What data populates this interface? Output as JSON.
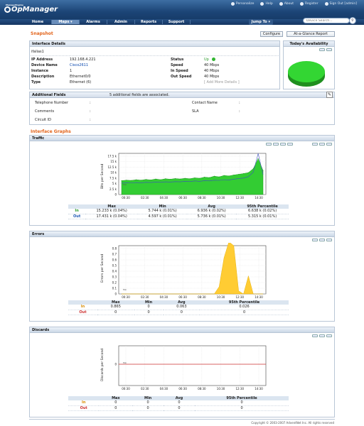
{
  "header": {
    "brand_small": "ManageEngine",
    "brand": "OpManager",
    "links": [
      "Personalize",
      "Help",
      "About",
      "Register",
      "Sign Out [admin]"
    ],
    "search_placeholder": "Device Search...",
    "jump_to": "Jump To ▾"
  },
  "nav": [
    {
      "label": "Home",
      "active": false
    },
    {
      "label": "Maps ▾",
      "active": true
    },
    {
      "label": "Alarms",
      "active": false
    },
    {
      "label": "Admin",
      "active": false
    },
    {
      "label": "Reports",
      "active": false
    },
    {
      "label": "Support",
      "active": false
    }
  ],
  "snapshot": {
    "title": "Snapshot",
    "configure_btn": "Configure",
    "glance_btn": "At-a-Glance Report",
    "details_title": "Interface Details",
    "alias": "ifalias1",
    "rows_left": [
      {
        "label": "IP Address",
        "value": "192.168.4.221"
      },
      {
        "label": "Device Name",
        "value": "Cisco2611"
      },
      {
        "label": "Instance",
        "value": "1"
      },
      {
        "label": "Description",
        "value": "Ethernet0/0"
      },
      {
        "label": "Type",
        "value": "Ethernet (6)"
      }
    ],
    "rows_right": [
      {
        "label": "Status",
        "value": "Up"
      },
      {
        "label": "Speed",
        "value": "40 Mbps"
      },
      {
        "label": "In Speed",
        "value": "40 Mbps"
      },
      {
        "label": "Out Speed",
        "value": "40 Mbps"
      }
    ],
    "add_more": "[ Add More Details ]",
    "availability_title": "Today's Availability",
    "availability_pct": 100
  },
  "additional": {
    "title": "Additional Fields",
    "note": "5 additional fields are associated.",
    "fields_left": [
      "Telephone Number",
      "Comments",
      "Circuit ID"
    ],
    "fields_right": [
      "Contact Name",
      "SLA"
    ],
    "sep": ":"
  },
  "graphs": {
    "section_title": "Interface Graphs",
    "traffic": {
      "title": "Traffic",
      "ylabel": "Bits per Second",
      "annotation": "Min",
      "yticks": [
        "17.5 k",
        "15 k",
        "12.5 k",
        "10 k",
        "7.5 k",
        "5 k",
        "2.5 k",
        "0"
      ],
      "xticks": [
        "00:30",
        "02:30",
        "04:30",
        "06:30",
        "08:30",
        "10:30",
        "12:30",
        "14:30"
      ],
      "headers": [
        "",
        "Max",
        "Min",
        "Avg",
        "95th Percentile"
      ],
      "rows": [
        {
          "label": "In",
          "max": "15.233 k  (0.04%)",
          "min": "5.744 k  (0.01%)",
          "avg": "6.936 k  (0.02%)",
          "p95": "6.638 k  (0.02%)"
        },
        {
          "label": "Out",
          "max": "17.431 k  (0.04%)",
          "min": "4.597 k  (0.01%)",
          "avg": "5.736 k  (0.01%)",
          "p95": "5.315 k  (0.01%)"
        }
      ]
    },
    "errors": {
      "title": "Errors",
      "ylabel": "Errors per Second",
      "annotation": "Min",
      "yticks": [
        "0.8",
        "0.7",
        "0.6",
        "0.5",
        "0.4",
        "0.3",
        "0.2",
        "0.1",
        "0"
      ],
      "xticks": [
        "00:30",
        "02:30",
        "04:30",
        "06:30",
        "08:30",
        "10:30",
        "12:30",
        "14:30"
      ],
      "headers": [
        "",
        "Max",
        "Min",
        "Avg",
        "95th Percentile"
      ],
      "rows": [
        {
          "label": "In",
          "max": "0.865",
          "min": "0",
          "avg": "0.063",
          "p95": "0.026"
        },
        {
          "label": "Out",
          "max": "0",
          "min": "0",
          "avg": "0",
          "p95": "0"
        }
      ]
    },
    "discards": {
      "title": "Discards",
      "ylabel": "Discards per Second",
      "annotation": "Min",
      "yticks": [
        "0"
      ],
      "xticks": [
        "00:30",
        "02:30",
        "04:30",
        "06:30",
        "08:30",
        "10:30",
        "12:30",
        "14:30"
      ],
      "headers": [
        "",
        "Max",
        "Min",
        "Avg",
        "95th Percentile"
      ],
      "rows": [
        {
          "label": "In",
          "max": "0",
          "min": "0",
          "avg": "0",
          "p95": "0"
        },
        {
          "label": "Out",
          "max": "0",
          "min": "0",
          "avg": "0",
          "p95": "0"
        }
      ]
    }
  },
  "chart_data": [
    {
      "type": "area",
      "title": "Traffic",
      "ylabel": "Bits per Second",
      "x": [
        "00:30",
        "01:00",
        "01:30",
        "02:00",
        "02:30",
        "03:00",
        "03:30",
        "04:00",
        "04:30",
        "05:00",
        "05:30",
        "06:00",
        "06:30",
        "07:00",
        "07:30",
        "08:00",
        "08:30",
        "09:00",
        "09:30",
        "10:00",
        "10:30",
        "11:00",
        "11:30",
        "12:00",
        "12:30",
        "13:00",
        "13:30",
        "14:00",
        "14:30",
        "15:00"
      ],
      "ylim": [
        0,
        17500
      ],
      "series": [
        {
          "name": "In",
          "values": [
            5900,
            6100,
            6000,
            6300,
            6100,
            6400,
            6200,
            6600,
            6300,
            6700,
            6500,
            6800,
            6600,
            6900,
            6700,
            7100,
            6900,
            7400,
            7200,
            7800,
            7500,
            8100,
            7900,
            8300,
            8600,
            8900,
            9300,
            11000,
            15233,
            10200
          ]
        },
        {
          "name": "Out",
          "values": [
            4800,
            5000,
            4900,
            5100,
            5000,
            5200,
            5100,
            5300,
            5200,
            5400,
            5300,
            5500,
            5400,
            5600,
            5500,
            5800,
            5600,
            5900,
            5800,
            6100,
            6000,
            6300,
            6200,
            6500,
            6800,
            7000,
            7600,
            9500,
            17431,
            8500
          ]
        }
      ]
    },
    {
      "type": "area",
      "title": "Errors",
      "ylabel": "Errors per Second",
      "x": [
        "00:30",
        "01:00",
        "01:30",
        "02:00",
        "02:30",
        "03:00",
        "03:30",
        "04:00",
        "04:30",
        "05:00",
        "05:30",
        "06:00",
        "06:30",
        "07:00",
        "07:30",
        "08:00",
        "08:30",
        "09:00",
        "09:30",
        "10:00",
        "10:30",
        "11:00",
        "11:30",
        "12:00",
        "12:30",
        "13:00",
        "13:30",
        "14:00",
        "14:30",
        "15:00"
      ],
      "ylim": [
        0,
        0.8
      ],
      "series": [
        {
          "name": "In",
          "values": [
            0,
            0,
            0,
            0,
            0,
            0,
            0,
            0,
            0,
            0,
            0,
            0,
            0,
            0,
            0,
            0,
            0,
            0,
            0,
            0,
            0.12,
            0.6,
            0.865,
            0.8,
            0.05,
            0,
            0.3,
            0,
            0,
            0
          ]
        },
        {
          "name": "Out",
          "values": [
            0,
            0,
            0,
            0,
            0,
            0,
            0,
            0,
            0,
            0,
            0,
            0,
            0,
            0,
            0,
            0,
            0,
            0,
            0,
            0,
            0,
            0,
            0,
            0,
            0,
            0,
            0,
            0,
            0,
            0
          ]
        }
      ]
    },
    {
      "type": "line",
      "title": "Discards",
      "ylabel": "Discards per Second",
      "x": [
        "00:30",
        "02:30",
        "04:30",
        "06:30",
        "08:30",
        "10:30",
        "12:30",
        "14:30"
      ],
      "series": [
        {
          "name": "In",
          "values": [
            0,
            0,
            0,
            0,
            0,
            0,
            0,
            0
          ]
        },
        {
          "name": "Out",
          "values": [
            0,
            0,
            0,
            0,
            0,
            0,
            0,
            0
          ]
        }
      ]
    }
  ],
  "colors": {
    "in": "#33cc33",
    "in_line": "#219921",
    "out": "#3d4fbf",
    "errors": "#ffcc33",
    "discards": "#cc3333",
    "accent": "#e2631a"
  },
  "footer": "Copyright © 2003-2007 AdventNet Inc. All rights reserved"
}
